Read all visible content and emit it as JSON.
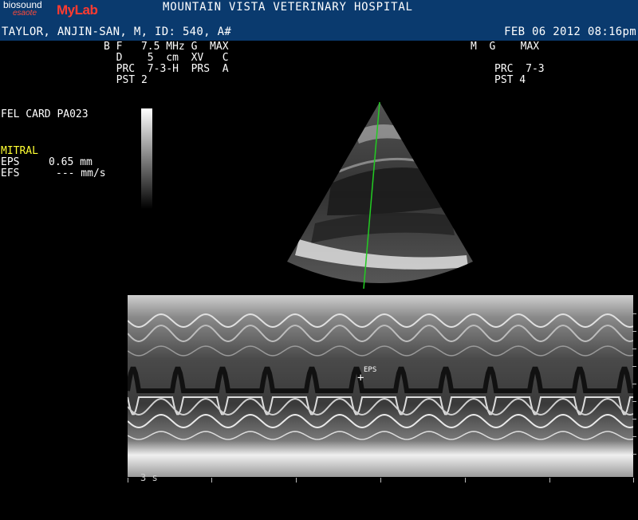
{
  "header": {
    "brand_biosound": "biosound",
    "brand_esaote": "esaote",
    "brand_mylab": "MyLab",
    "hospital_title": "MOUNTAIN VISTA VETERINARY HOSPITAL",
    "patient_line": "TAYLOR, ANJIN-SAN, M, ID: 540, A#",
    "datetime": "FEB 06 2012 08:16pm"
  },
  "bmode_params": {
    "row1": "B F   7.5 MHz G  MAX",
    "row2": "  D    5  cm  XV   C",
    "row3": "  PRC  7-3-H  PRS  A",
    "row4": "  PST 2"
  },
  "mmode_params": {
    "row1": "M  G    MAX",
    "row2": "PRC  7-3",
    "row3": "PST 4"
  },
  "study": {
    "preset": "FEL CARD PA023",
    "section": "MITRAL",
    "eps_label": "EPS",
    "eps_value": "0.65 mm",
    "efs_label": "EFS",
    "efs_value": "--- mm/s"
  },
  "marker": {
    "caliper_label": "EPS"
  },
  "timescale": {
    "label": "3 s"
  },
  "colors": {
    "header_bg": "#0a3a6e",
    "highlight_text": "#ffff33",
    "cursor_line": "#22cc22"
  }
}
